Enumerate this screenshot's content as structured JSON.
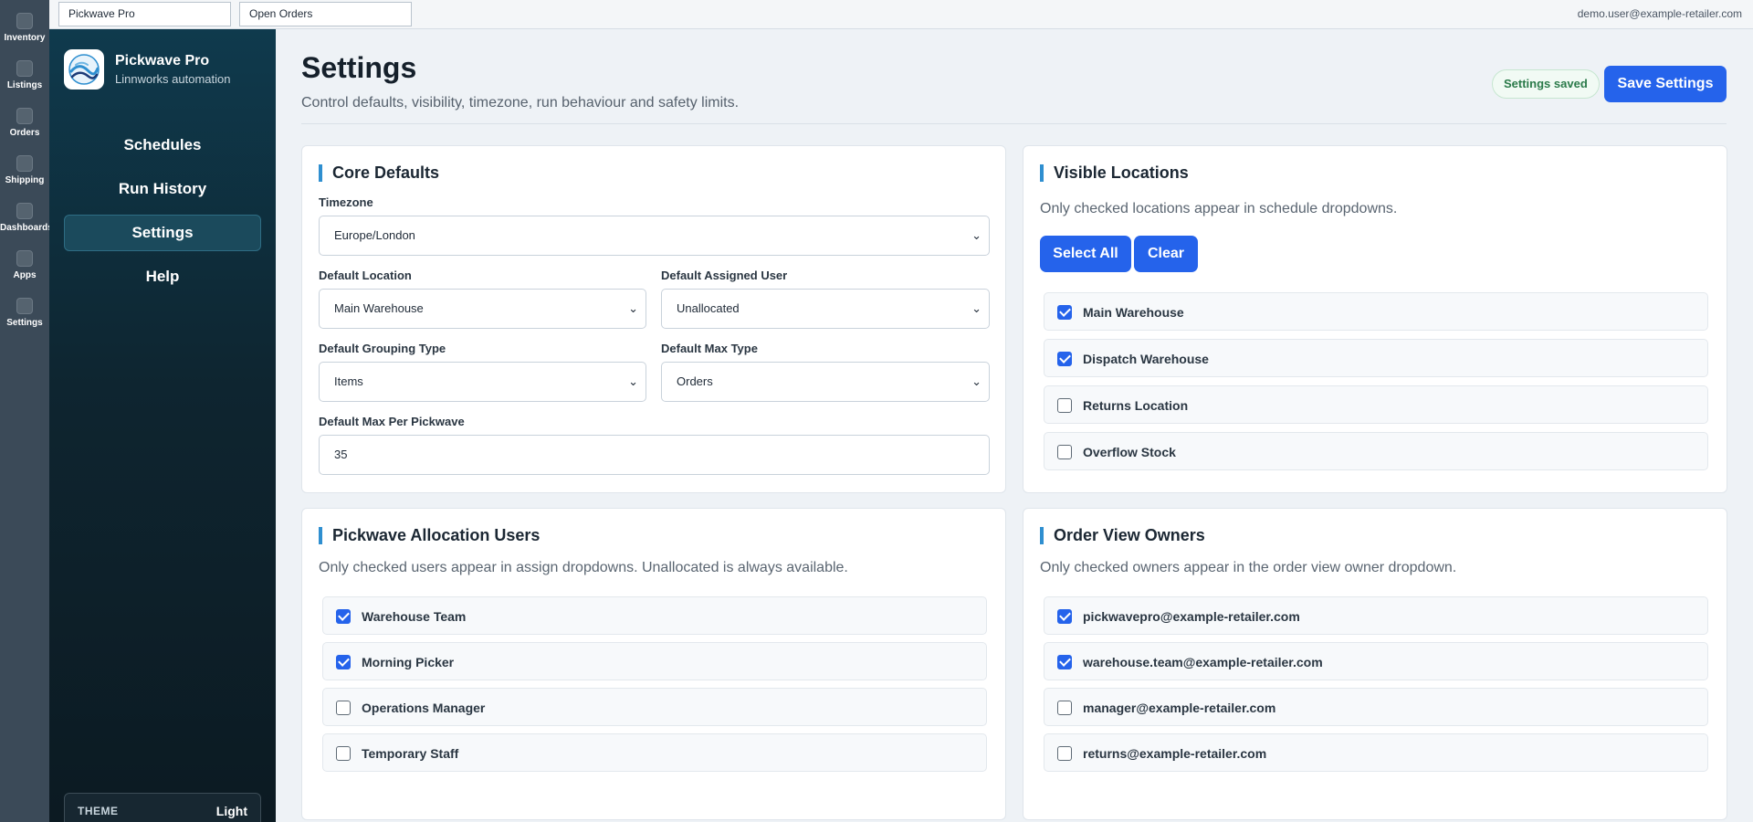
{
  "rail": [
    {
      "label": "Inventory"
    },
    {
      "label": "Listings"
    },
    {
      "label": "Orders"
    },
    {
      "label": "Shipping"
    },
    {
      "label": "Dashboards"
    },
    {
      "label": "Apps"
    },
    {
      "label": "Settings"
    }
  ],
  "topbar": {
    "box1": "Pickwave Pro",
    "box2": "Open Orders",
    "user": "demo.user@example-retailer.com"
  },
  "sidebar": {
    "title": "Pickwave Pro",
    "subtitle": "Linnworks automation",
    "nav": [
      "Schedules",
      "Run History",
      "Settings",
      "Help"
    ],
    "active": "Settings",
    "theme_label": "THEME",
    "theme_value": "Light"
  },
  "header": {
    "title": "Settings",
    "subtitle": "Control defaults, visibility, timezone, run behaviour and safety limits.",
    "saved_badge": "Settings saved",
    "save_button": "Save Settings"
  },
  "core": {
    "title": "Core Defaults",
    "timezone_label": "Timezone",
    "timezone_value": "Europe/London",
    "location_label": "Default Location",
    "location_value": "Main Warehouse",
    "user_label": "Default Assigned User",
    "user_value": "Unallocated",
    "grouping_label": "Default Grouping Type",
    "grouping_value": "Items",
    "maxtype_label": "Default Max Type",
    "maxtype_value": "Orders",
    "maxper_label": "Default Max Per Pickwave",
    "maxper_value": "35"
  },
  "locations": {
    "title": "Visible Locations",
    "desc": "Only checked locations appear in schedule dropdowns.",
    "select_all": "Select All",
    "clear": "Clear",
    "items": [
      {
        "label": "Main Warehouse",
        "checked": true
      },
      {
        "label": "Dispatch Warehouse",
        "checked": true
      },
      {
        "label": "Returns Location",
        "checked": false
      },
      {
        "label": "Overflow Stock",
        "checked": false
      }
    ]
  },
  "users": {
    "title": "Pickwave Allocation Users",
    "desc": "Only checked users appear in assign dropdowns. Unallocated is always available.",
    "items": [
      {
        "label": "Warehouse Team",
        "checked": true
      },
      {
        "label": "Morning Picker",
        "checked": true
      },
      {
        "label": "Operations Manager",
        "checked": false
      },
      {
        "label": "Temporary Staff",
        "checked": false
      }
    ]
  },
  "owners": {
    "title": "Order View Owners",
    "desc": "Only checked owners appear in the order view owner dropdown.",
    "items": [
      {
        "label": "pickwavepro@example-retailer.com",
        "checked": true
      },
      {
        "label": "warehouse.team@example-retailer.com",
        "checked": true
      },
      {
        "label": "manager@example-retailer.com",
        "checked": false
      },
      {
        "label": "returns@example-retailer.com",
        "checked": false
      }
    ]
  },
  "colors": {
    "accent": "#2563eb",
    "sidebar": "#0e2530",
    "rail": "#3b4a58",
    "saved": "#2b7a4a"
  }
}
